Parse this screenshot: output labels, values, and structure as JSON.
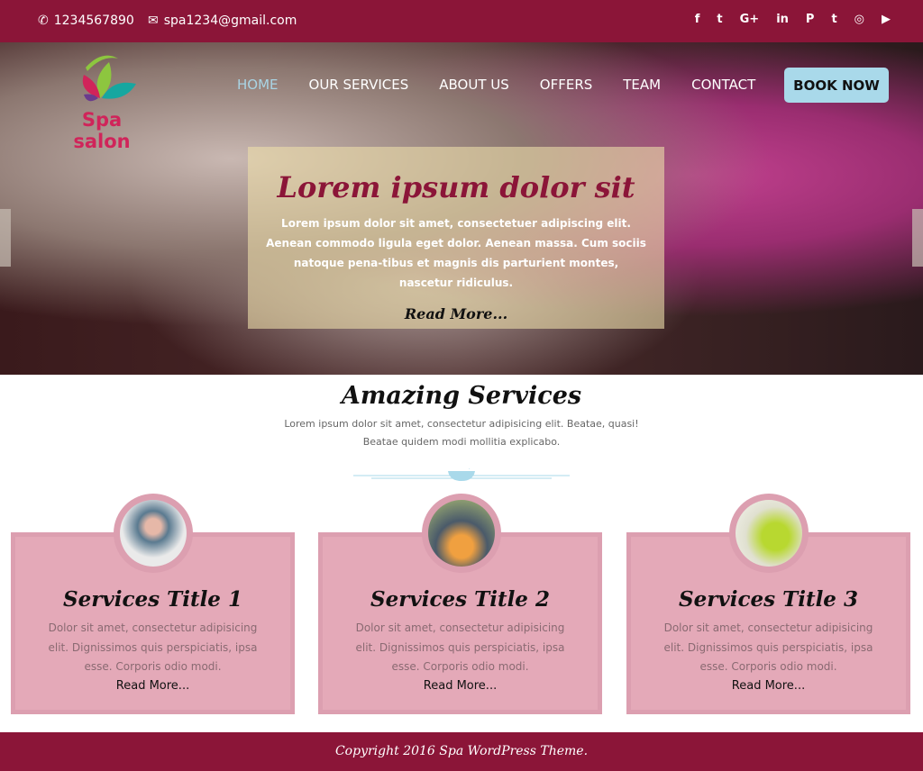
{
  "topbar": {
    "phone": "1234567890",
    "email": "spa1234@gmail.com",
    "social": [
      "f",
      "t",
      "G+",
      "in",
      "P",
      "t",
      "◎",
      "▶"
    ],
    "social_names": [
      "facebook",
      "twitter",
      "google-plus",
      "linkedin",
      "pinterest",
      "tumblr",
      "instagram",
      "youtube"
    ]
  },
  "logo": {
    "text": "Spa salon"
  },
  "nav": {
    "items": [
      "HOME",
      "OUR SERVICES",
      "ABOUT US",
      "OFFERS",
      "TEAM",
      "CONTACT"
    ],
    "book": "BOOK NOW"
  },
  "slide": {
    "title": "Lorem ipsum dolor sit",
    "text": "Lorem ipsum dolor sit amet, consectetuer adipiscing elit. Aenean commodo ligula eget dolor. Aenean massa. Cum sociis natoque pena-tibus et magnis dis parturient montes, nascetur ridiculus.",
    "read_more": "Read More..."
  },
  "services": {
    "title": "Amazing Services",
    "line1": "Lorem ipsum dolor sit amet, consectetur adipisicing elit. Beatae, quasi!",
    "line2": "Beatae quidem modi mollitia explicabo.",
    "cards": [
      {
        "title": "Services Title 1",
        "text": "Dolor sit amet, consectetur adipisicing elit. Dignissimos quis perspiciatis, ipsa esse. Corporis odio modi.",
        "read_more": "Read More..."
      },
      {
        "title": "Services Title 2",
        "text": "Dolor sit amet, consectetur adipisicing elit. Dignissimos quis perspiciatis, ipsa esse. Corporis odio modi.",
        "read_more": "Read More..."
      },
      {
        "title": "Services Title 3",
        "text": "Dolor sit amet, consectetur adipisicing elit. Dignissimos quis perspiciatis, ipsa esse. Corporis odio modi.",
        "read_more": "Read More..."
      }
    ]
  },
  "footer": {
    "text": "Copyright 2016 Spa WordPress Theme."
  },
  "colors": {
    "brand": "#8b1538",
    "card": "#e4a9b8",
    "button": "#a9d9ea"
  }
}
